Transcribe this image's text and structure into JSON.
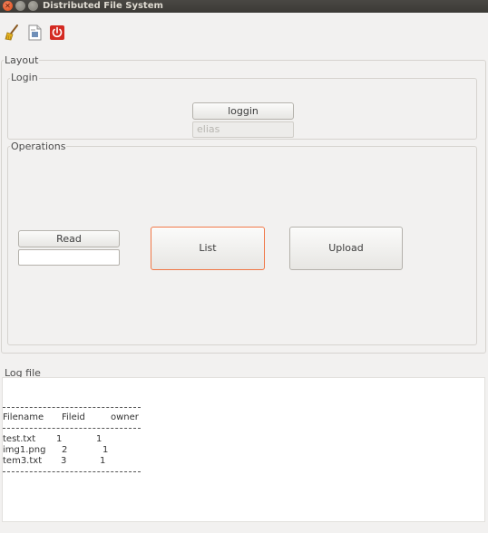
{
  "window": {
    "title": "Distributed File System"
  },
  "toolbar": {
    "icons": [
      "broom-icon",
      "document-icon",
      "power-icon"
    ]
  },
  "layout_group": {
    "label": "Layout"
  },
  "login_group": {
    "label": "Login",
    "login_button": "loggin",
    "username_value": "elias"
  },
  "operations_group": {
    "label": "Operations",
    "read_button": "Read",
    "read_input_value": "",
    "list_button": "List",
    "upload_button": "Upload"
  },
  "log": {
    "label": "Log file",
    "headers": [
      "Filename",
      "Fileid",
      "owner"
    ],
    "rows": [
      [
        "test.txt",
        "1",
        "1"
      ],
      [
        "img1.png",
        "2",
        "1"
      ],
      [
        "tem3.txt",
        "3",
        "1"
      ]
    ]
  },
  "colors": {
    "title_bar": "#3b3a36",
    "close_button": "#df4a16",
    "focus_border": "#f07746",
    "window_bg": "#f2f1f0"
  }
}
